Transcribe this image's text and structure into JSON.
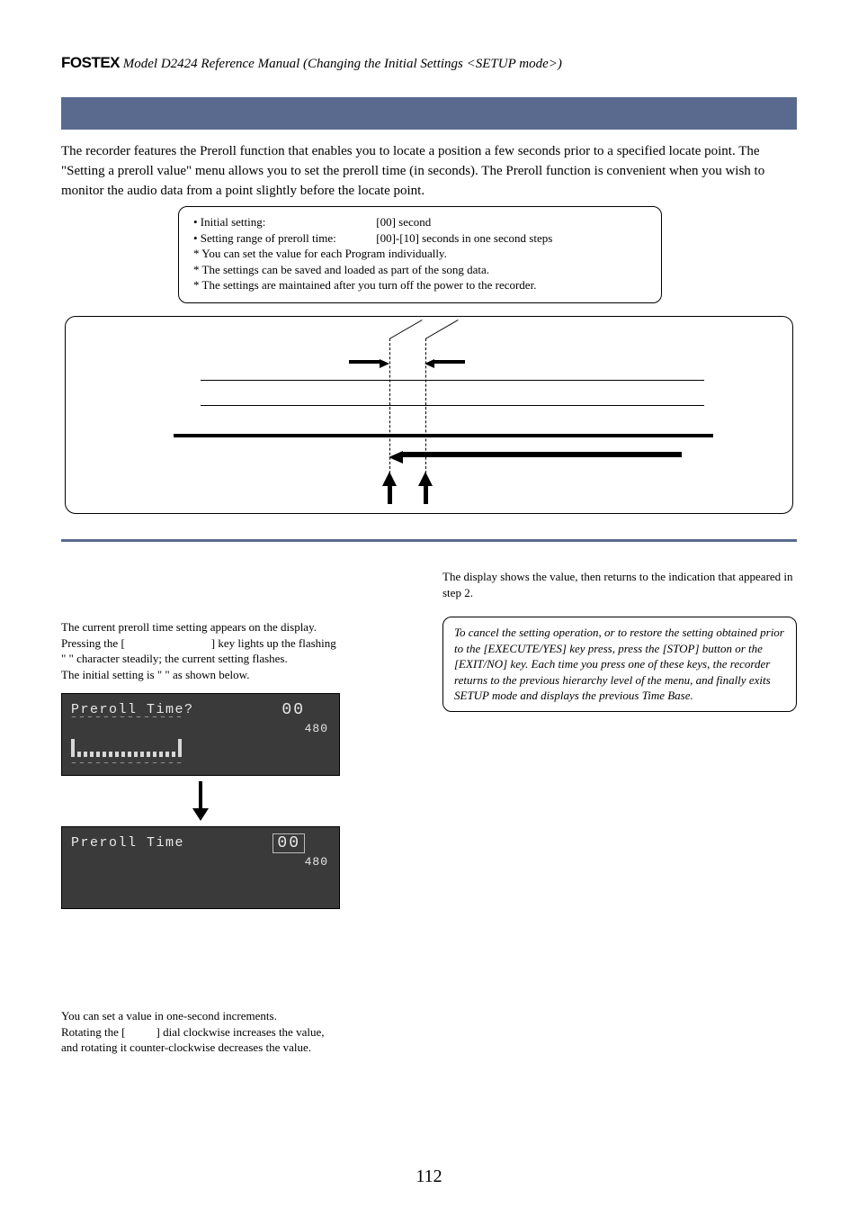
{
  "header": {
    "logo": "FOSTEX",
    "title": "Model D2424  Reference Manual (Changing the Initial Settings <SETUP mode>)"
  },
  "intro": "The recorder features the Preroll function that enables you to locate a position a few seconds prior to a specified locate point.  The \"Setting a preroll value\" menu allows you to set the preroll time (in seconds).  The Preroll function is convenient when you wish to monitor the audio data from a point slightly before the locate point.",
  "infobox": {
    "line1_label": "• Initial setting:",
    "line1_value": "[00] second",
    "line2_label": "• Setting range of preroll time:",
    "line2_value": "[00]-[10] seconds in one second steps",
    "note1": "* You can set the value for each Program individually.",
    "note2": "* The settings can be saved and loaded as part of the song data.",
    "note3": "* The settings are maintained after you turn off the power to the recorder."
  },
  "left": {
    "p1a": "The current preroll time setting appears on the display.",
    "p1b_pre": "Pressing the [",
    "p1b_post": "] key lights up the flashing",
    "p1c": "\"   \" character steadily; the current setting flashes.",
    "p1d": "The initial setting is \"     \" as shown below.",
    "lcd1_line": "Preroll Time?",
    "lcd1_big": "00",
    "lcd1_small": "480",
    "lcd2_line": "Preroll Time",
    "lcd2_big": "00",
    "lcd2_small": "480",
    "p2a": "You can set a value in one-second increments.",
    "p2b_pre": "Rotating the [",
    "p2b_post": "] dial clockwise increases the value,",
    "p2c": "and rotating it counter-clockwise decreases the value."
  },
  "right": {
    "p1": "The display shows the value, then returns to the indication that appeared in step 2.",
    "cancel": "To cancel the setting operation, or to restore the setting obtained prior to the [EXECUTE/YES] key press, press the [STOP] button or the [EXIT/NO] key.  Each time you press one of these keys, the recorder returns to the previous hierarchy level of the menu, and finally exits SETUP mode and displays the previous Time Base."
  },
  "page": "112"
}
